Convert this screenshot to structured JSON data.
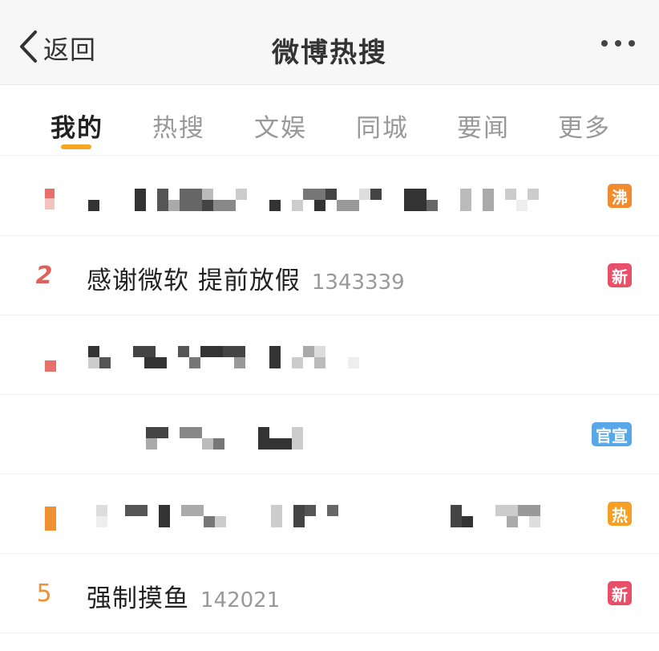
{
  "header": {
    "back_label": "返回",
    "title": "微博热搜"
  },
  "tabs": [
    {
      "label": "我的",
      "active": true
    },
    {
      "label": "热搜",
      "active": false
    },
    {
      "label": "文娱",
      "active": false
    },
    {
      "label": "同城",
      "active": false
    },
    {
      "label": "要闻",
      "active": false
    },
    {
      "label": "更多",
      "active": false
    }
  ],
  "colors": {
    "accent": "#f5a623",
    "boil": "#f28a2e",
    "new": "#e8506a",
    "official": "#58a7e8",
    "hot": "#f5a025",
    "rank_red": "#e0605a",
    "rank_orange": "#f09030"
  },
  "items": [
    {
      "rank": "",
      "title": "",
      "count": "",
      "badge": "沸",
      "blurred": true
    },
    {
      "rank": "2",
      "title": "感谢微软 提前放假",
      "count": "1343339",
      "badge": "新",
      "blurred": false
    },
    {
      "rank": "",
      "title": "",
      "count": "",
      "badge": "",
      "blurred": true
    },
    {
      "rank": "",
      "title": "",
      "count": "",
      "badge": "官宣",
      "blurred": true
    },
    {
      "rank": "",
      "title": "",
      "count": "",
      "badge": "热",
      "blurred": true
    },
    {
      "rank": "5",
      "title": "强制摸鱼",
      "count": "142021",
      "badge": "新",
      "blurred": false
    }
  ]
}
